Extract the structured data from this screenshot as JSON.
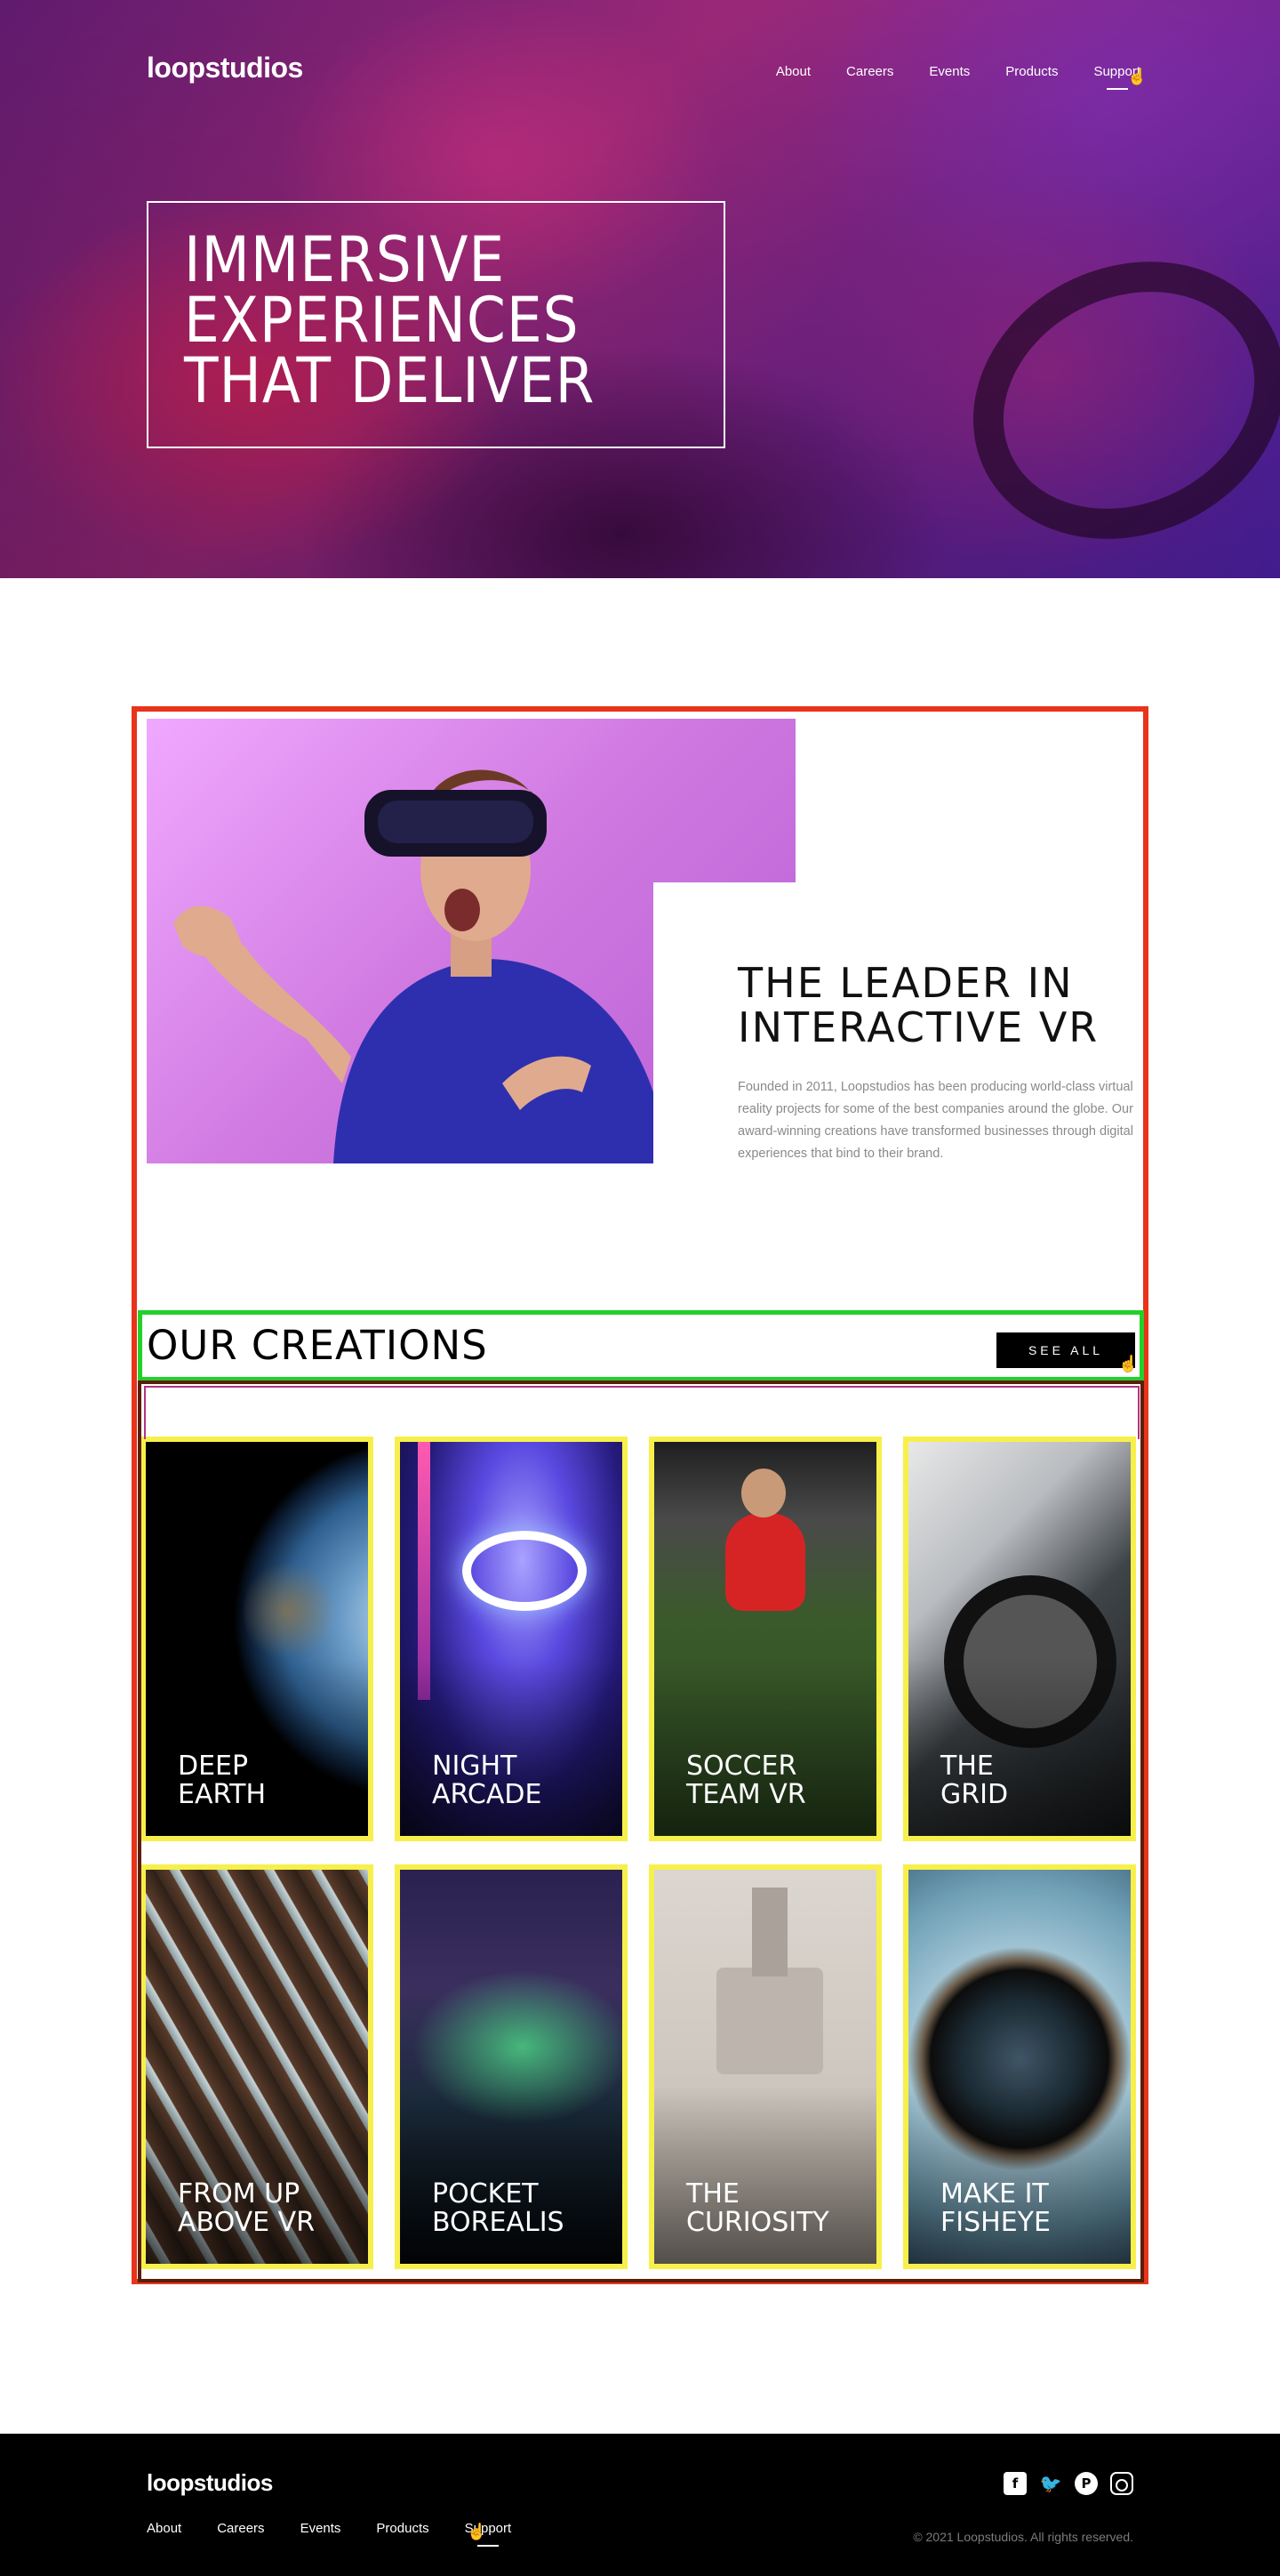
{
  "header": {
    "logo": "loopstudios",
    "nav": [
      "About",
      "Careers",
      "Events",
      "Products",
      "Support"
    ],
    "active_nav": "Support"
  },
  "hero": {
    "title": "Immersive experiences that deliver"
  },
  "intro": {
    "heading": "The leader in interactive VR",
    "body": "Founded in 2011, Loopstudios has been producing world-class virtual reality projects for some of the best companies around the globe. Our award-winning creations have transformed businesses through digital experiences that bind to their brand."
  },
  "creations": {
    "title": "Our creations",
    "see_all": "See all",
    "items": [
      {
        "label": "Deep\nEarth"
      },
      {
        "label": "Night\nArcade"
      },
      {
        "label": "Soccer\nTeam VR"
      },
      {
        "label": "The\nGrid"
      },
      {
        "label": "From Up\nAbove VR"
      },
      {
        "label": "Pocket\nBorealis"
      },
      {
        "label": "The\nCuriosity"
      },
      {
        "label": "Make it\nFisheye"
      }
    ]
  },
  "footer": {
    "logo": "loopstudios",
    "nav": [
      "About",
      "Careers",
      "Events",
      "Products",
      "Support"
    ],
    "copyright": "© 2021 Loopstudios. All rights reserved.",
    "socials": [
      "facebook-icon",
      "twitter-icon",
      "pinterest-icon",
      "instagram-icon"
    ]
  },
  "colors": {
    "annotation_red": "#e8341a",
    "annotation_green": "#22d02a",
    "annotation_yellow": "#f7f04a"
  }
}
